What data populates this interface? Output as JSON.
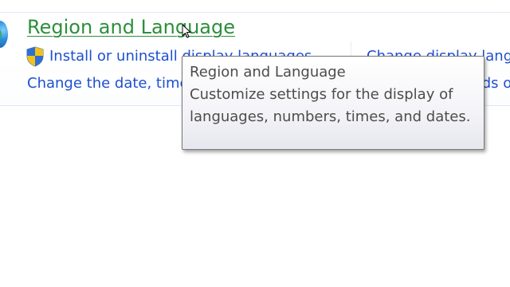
{
  "category": {
    "title": "Region and Language",
    "tasks": {
      "install": "Install or uninstall display languages",
      "change_date": "Change the date, time, or number format",
      "right_1": "Change display language",
      "right_2": "Change keyboards or other input methods"
    }
  },
  "tooltip": {
    "title": "Region and Language",
    "body": "Customize settings for the display of languages, numbers, times, and dates."
  },
  "icons": {
    "globe": "globe-icon",
    "shield": "uac-shield-icon",
    "cursor": "mouse-pointer-icon"
  },
  "colors": {
    "title_link": "#2d8f3b",
    "task_link": "#1e4fd1",
    "tooltip_text": "#4c4c4c"
  }
}
